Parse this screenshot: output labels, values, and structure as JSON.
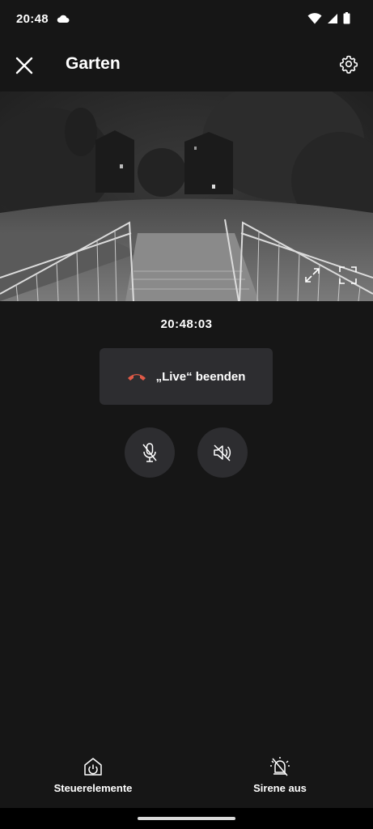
{
  "status_bar": {
    "time": "20:48",
    "icons": [
      "cloud-icon",
      "wifi-icon",
      "cellular-signal-icon",
      "battery-icon"
    ]
  },
  "header": {
    "title": "Garten",
    "close_icon": "close-icon",
    "settings_icon": "gear-icon"
  },
  "video": {
    "controls": [
      "expand-diagonal-icon",
      "fullscreen-icon"
    ]
  },
  "timestamp": "20:48:03",
  "live": {
    "end_label": "„Live“ beenden",
    "end_icon": "hang-up-icon",
    "end_icon_color": "#e05a47"
  },
  "audio_controls": {
    "microphone_icon": "microphone-muted-icon",
    "speaker_icon": "speaker-muted-icon"
  },
  "bottom_bar": {
    "items": [
      {
        "label": "Steuerelemente",
        "icon": "home-power-icon"
      },
      {
        "label": "Sirene aus",
        "icon": "siren-off-icon"
      }
    ]
  },
  "colors": {
    "background": "#161616",
    "button_surface": "#2d2d30",
    "accent_red": "#e05a47"
  }
}
